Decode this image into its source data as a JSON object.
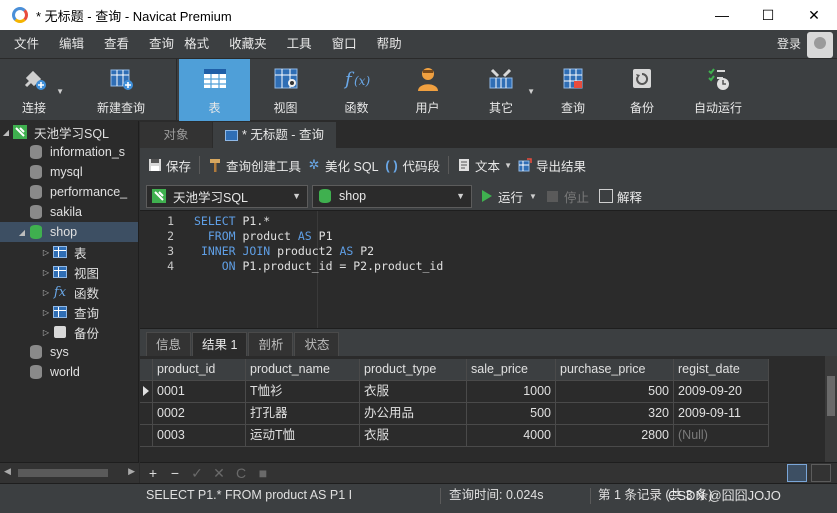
{
  "window": {
    "title": "* 无标题 - 查询 - Navicat Premium",
    "minimize": "—",
    "maximize": "☐",
    "close": "✕"
  },
  "menu": {
    "items": [
      "文件",
      "编辑",
      "查看",
      "查询",
      "格式",
      "收藏夹",
      "工具",
      "窗口",
      "帮助"
    ],
    "login": "登录"
  },
  "toolbar": {
    "items": [
      {
        "label": "连接",
        "icon": "plug-icon"
      },
      {
        "label": "新建查询",
        "icon": "new-query-icon"
      },
      {
        "label": "表",
        "icon": "table-icon",
        "active": true
      },
      {
        "label": "视图",
        "icon": "view-icon"
      },
      {
        "label": "函数",
        "icon": "function-icon"
      },
      {
        "label": "用户",
        "icon": "user-icon"
      },
      {
        "label": "其它",
        "icon": "other-icon"
      },
      {
        "label": "查询",
        "icon": "query-icon"
      },
      {
        "label": "备份",
        "icon": "backup-icon"
      },
      {
        "label": "自动运行",
        "icon": "automation-icon"
      }
    ]
  },
  "nav": {
    "connection": "天池学习SQL",
    "databases": [
      "information_s",
      "mysql",
      "performance_",
      "sakila"
    ],
    "open_db": "shop",
    "children": [
      "表",
      "视图",
      "函数",
      "查询",
      "备份"
    ],
    "more_dbs": [
      "sys",
      "world"
    ]
  },
  "tabs": {
    "objects": "对象",
    "query": "* 无标题 - 查询"
  },
  "editor_toolbar": {
    "save": "保存",
    "builder": "查询创建工具",
    "beautify": "美化 SQL",
    "snippet": "代码段",
    "text": "文本",
    "export": "导出结果"
  },
  "selectors": {
    "connection": "天池学习SQL",
    "database": "shop",
    "run": "运行",
    "stop": "停止",
    "explain": "解释"
  },
  "sql": {
    "lines": [
      {
        "num": "1",
        "indent": "",
        "parts": [
          {
            "t": "kw",
            "v": "SELECT"
          },
          {
            "t": "txt",
            "v": " P1.*"
          }
        ]
      },
      {
        "num": "2",
        "indent": "  ",
        "parts": [
          {
            "t": "kw",
            "v": "FROM"
          },
          {
            "t": "txt",
            "v": " product "
          },
          {
            "t": "kw",
            "v": "AS"
          },
          {
            "t": "txt",
            "v": " P1"
          }
        ]
      },
      {
        "num": "3",
        "indent": " ",
        "parts": [
          {
            "t": "kw",
            "v": "INNER JOIN"
          },
          {
            "t": "txt",
            "v": " product2 "
          },
          {
            "t": "kw",
            "v": "AS"
          },
          {
            "t": "txt",
            "v": " P2"
          }
        ]
      },
      {
        "num": "4",
        "indent": "    ",
        "parts": [
          {
            "t": "kw",
            "v": "ON"
          },
          {
            "t": "txt",
            "v": " P1.product_id = P2.product_id"
          }
        ]
      }
    ]
  },
  "result_tabs": [
    "信息",
    "结果 1",
    "剖析",
    "状态"
  ],
  "grid": {
    "columns": [
      "product_id",
      "product_name",
      "product_type",
      "sale_price",
      "purchase_price",
      "regist_date"
    ],
    "rows": [
      [
        "0001",
        "T恤衫",
        "衣服",
        "1000",
        "500",
        "2009-09-20"
      ],
      [
        "0002",
        "打孔器",
        "办公用品",
        "500",
        "320",
        "2009-09-11"
      ],
      [
        "0003",
        "运动T恤",
        "衣服",
        "4000",
        "2800",
        "(Null)"
      ]
    ]
  },
  "grid_bar": {
    "add": "+",
    "remove": "−",
    "apply": "✓",
    "discard": "✕",
    "refresh": "C",
    "stop": "■"
  },
  "status": {
    "sql": "SELECT P1.*   FROM product AS P1   I",
    "time": "查询时间: 0.024s",
    "record": "第 1 条记录 (共 3 条)",
    "watermark": "CSDN @囧囧JOJO"
  }
}
